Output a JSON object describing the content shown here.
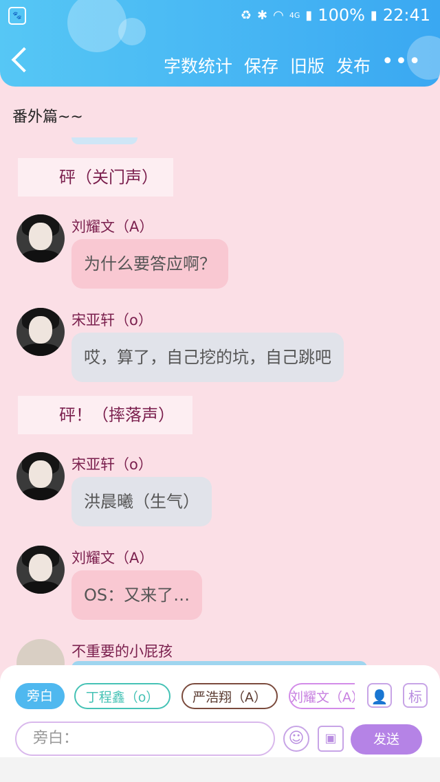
{
  "status_bar": {
    "battery": "100%",
    "time": "22:41",
    "network": "4G"
  },
  "nav": {
    "items": [
      "字数统计",
      "保存",
      "旧版",
      "发布"
    ],
    "more": "•••"
  },
  "chapter_title": "番外篇~~",
  "messages": [
    {
      "type": "narration",
      "text": "砰（关门声）"
    },
    {
      "type": "chat",
      "name": "刘耀文（A）",
      "text": "为什么要答应啊？",
      "style": "pink"
    },
    {
      "type": "chat",
      "name": "宋亚轩（o）",
      "text": "哎，算了，自己挖的坑，自己跳吧",
      "style": "gray"
    },
    {
      "type": "narration",
      "text": "砰！（摔落声）"
    },
    {
      "type": "chat",
      "name": "宋亚轩（o）",
      "text": "洪晨曦（生气）",
      "style": "gray"
    },
    {
      "type": "chat",
      "name": "刘耀文（A）",
      "text": "OS：又来了…",
      "style": "pink"
    },
    {
      "type": "chat",
      "name": "不重要的小屁孩",
      "text": "",
      "style": "blue"
    }
  ],
  "roles": [
    {
      "label": "旁白",
      "selected": true,
      "color": "#4fb8ef"
    },
    {
      "label": "丁程鑫（o）",
      "selected": false,
      "color": "#45c2b5"
    },
    {
      "label": "严浩翔（A）",
      "selected": false,
      "color": "#7a4a3c"
    },
    {
      "label": "刘耀文（A）",
      "selected": false,
      "color": "#d28be8"
    }
  ],
  "input": {
    "placeholder": "旁白："
  },
  "buttons": {
    "mark": "标",
    "send": "发送"
  },
  "colors": {
    "accent": "#b583e6",
    "topbar": "#3aa8f2",
    "background": "#fbdfe6"
  }
}
